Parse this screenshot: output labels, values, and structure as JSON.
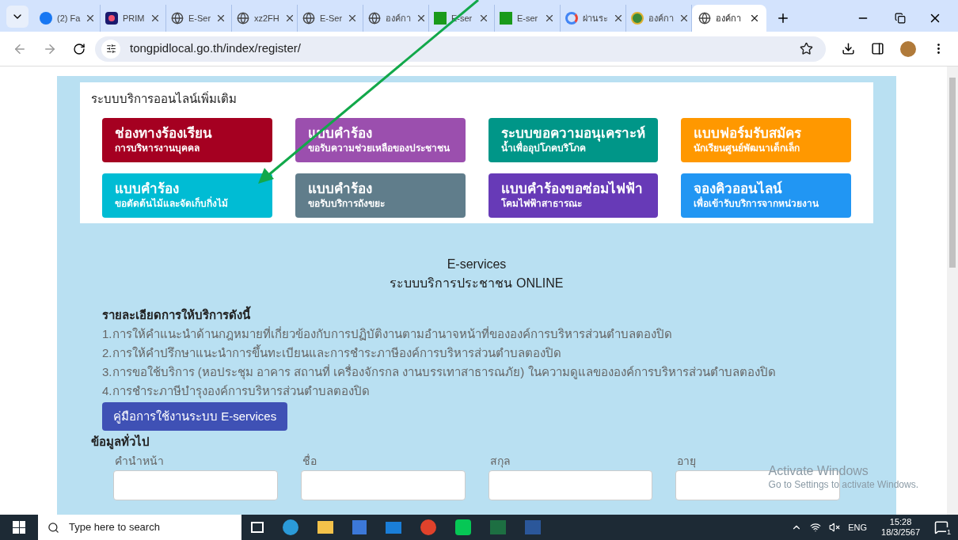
{
  "browser": {
    "tabs": [
      {
        "title": "(2) Fa",
        "kind": "facebook",
        "selected": false
      },
      {
        "title": "PRIM",
        "kind": "shop",
        "selected": false
      },
      {
        "title": "E-Ser",
        "kind": "globe",
        "selected": false
      },
      {
        "title": "xz2FH",
        "kind": "globe",
        "selected": false
      },
      {
        "title": "E-Ser",
        "kind": "globe",
        "selected": false
      },
      {
        "title": "องค์กา",
        "kind": "globe",
        "selected": false
      },
      {
        "title": "E-ser",
        "kind": "eservice",
        "selected": false
      },
      {
        "title": "E-ser",
        "kind": "eservice",
        "selected": false
      },
      {
        "title": "ผ่านระ",
        "kind": "google",
        "selected": false
      },
      {
        "title": "องค์กา",
        "kind": "seal",
        "selected": false
      },
      {
        "title": "องค์กา",
        "kind": "globe",
        "selected": true
      }
    ],
    "url": "tongpidlocal.go.th/index/register/"
  },
  "services_card": {
    "heading": "ระบบบริการออนไลน์เพิ่มเติม",
    "tiles": [
      {
        "title": "ช่องทางร้องเรียน",
        "subtitle": "การบริหารงานบุคคล",
        "color": "#a50021"
      },
      {
        "title": "แบบคำร้อง",
        "subtitle": "ขอรับความช่วยเหลือของประชาชน",
        "color": "#9b4fae"
      },
      {
        "title": "ระบบขอความอนุเคราะห์",
        "subtitle": "น้ำเพื่ออุปโภคบริโภค",
        "color": "#009688"
      },
      {
        "title": "แบบฟอร์มรับสมัคร",
        "subtitle": "นักเรียนศูนย์พัฒนาเด็กเล็ก",
        "color": "#ff9800"
      },
      {
        "title": "แบบคำร้อง",
        "subtitle": "ขอตัดต้นไม้และจัดเก็บกิ่งไม้",
        "color": "#00bcd4"
      },
      {
        "title": "แบบคำร้อง",
        "subtitle": "ขอรับบริการถังขยะ",
        "color": "#607d8b"
      },
      {
        "title": "แบบคำร้องขอซ่อมไฟฟ้า",
        "subtitle": "โคมไฟฟ้าสาธารณะ",
        "color": "#673ab7"
      },
      {
        "title": "จองคิวออนไลน์",
        "subtitle": "เพื่อเข้ารับบริการจากหน่วยงาน",
        "color": "#2196f3"
      }
    ]
  },
  "title_lines": [
    "E-services",
    "ระบบบริการประชาชน ONLINE"
  ],
  "details": {
    "heading": "รายละเอียดการให้บริการดังนี้",
    "items": [
      "1.การให้คำแนะนำด้านกฎหมายที่เกี่ยวข้องกับการปฏิบัติงานตามอำนาจหน้าที่ขององค์การบริหารส่วนตำบลตองปิด",
      "2.การให้คำปรึกษาแนะนำการขึ้นทะเบียนและการชำระภาษีองค์การบริหารส่วนตำบลตองปิด",
      "3.การขอใช้บริการ (หอประชุม อาคาร สถานที่ เครื่องจักรกล งานบรรเทาสาธารณภัย) ในความดูแลขององค์การบริหารส่วนตำบลตองปิด",
      "4.การชำระภาษีบำรุงองค์การบริหารส่วนตำบลตองปิด"
    ]
  },
  "manual_button": "คู่มือการใช้งานระบบ E-services",
  "general_info": {
    "heading": "ข้อมูลทั่วไป",
    "fields": [
      "คำนำหน้า",
      "ชื่อ",
      "สกุล",
      "อายุ"
    ]
  },
  "activation_notice": {
    "title": "Activate Windows",
    "text": "Go to Settings to activate Windows."
  },
  "taskbar": {
    "search_placeholder": "Type here to search",
    "language": "ENG",
    "time": "15:28",
    "date": "18/3/2567",
    "notification_count": "1"
  }
}
